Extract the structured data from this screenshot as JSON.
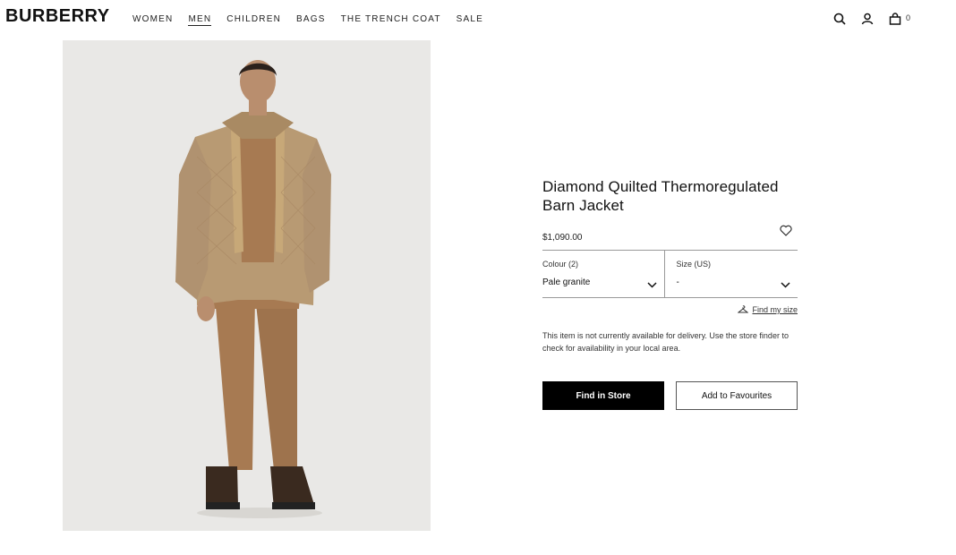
{
  "header": {
    "logo": "BURBERRY",
    "nav": [
      {
        "label": "WOMEN"
      },
      {
        "label": "MEN"
      },
      {
        "label": "CHILDREN"
      },
      {
        "label": "BAGS"
      },
      {
        "label": "THE TRENCH COAT"
      },
      {
        "label": "SALE"
      }
    ],
    "active_nav": "MEN",
    "icons": [
      "search-icon",
      "account-icon",
      "bag-icon"
    ],
    "bag_count": "0"
  },
  "product": {
    "title": "Diamond Quilted Thermoregulated Barn Jacket",
    "price": "$1,090.00",
    "colour_label": "Colour (2)",
    "colour_value": "Pale granite",
    "size_label": "Size (US)",
    "size_value": "-",
    "find_size": "Find my size",
    "notice": "This item is not currently available for delivery. Use the store finder to check for availability in your local area.",
    "primary_button": "Find in Store",
    "secondary_button": "Add to Favourites"
  },
  "colors": {
    "image_bg": "#e9e8e6",
    "jacket": "#b89a73",
    "trousers": "#a77a52",
    "primary_button_bg": "#000000"
  }
}
